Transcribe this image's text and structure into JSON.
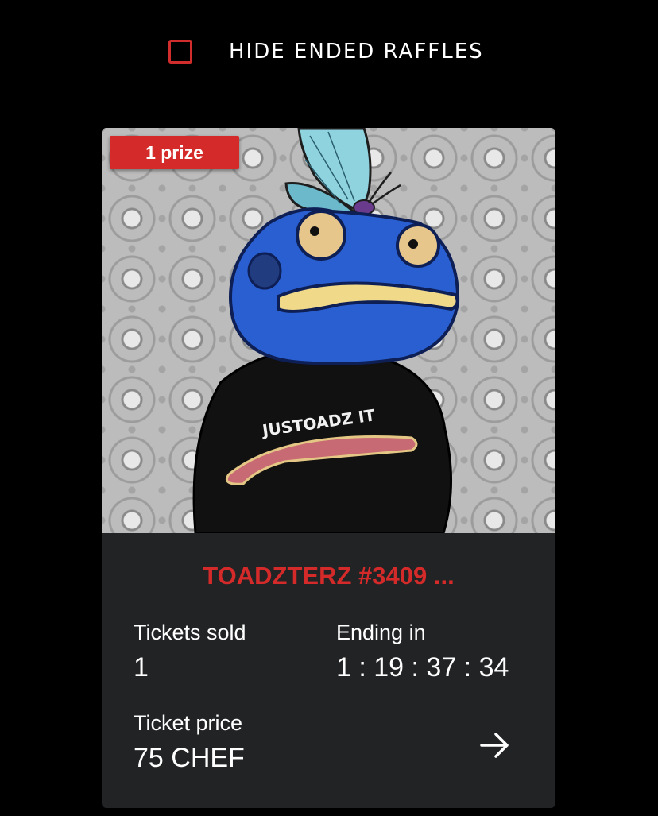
{
  "filter": {
    "label": "HIDE ENDED RAFFLES",
    "checked": false
  },
  "raffle": {
    "prize_badge": "1 prize",
    "title": "TOADZTERZ #3409 ...",
    "image_caption": "JUSTOADZ IT",
    "tickets_sold_label": "Tickets sold",
    "tickets_sold_value": "1",
    "ending_label": "Ending in",
    "ending_value": "1 : 19 : 37 : 34",
    "ticket_price_label": "Ticket price",
    "ticket_price_value": "75 CHEF"
  },
  "icons": {
    "details": "arrow-right-icon",
    "checkbox": "checkbox-empty-icon"
  },
  "colors": {
    "accent": "#d42a2a",
    "card": "#222325",
    "background": "#000000"
  }
}
